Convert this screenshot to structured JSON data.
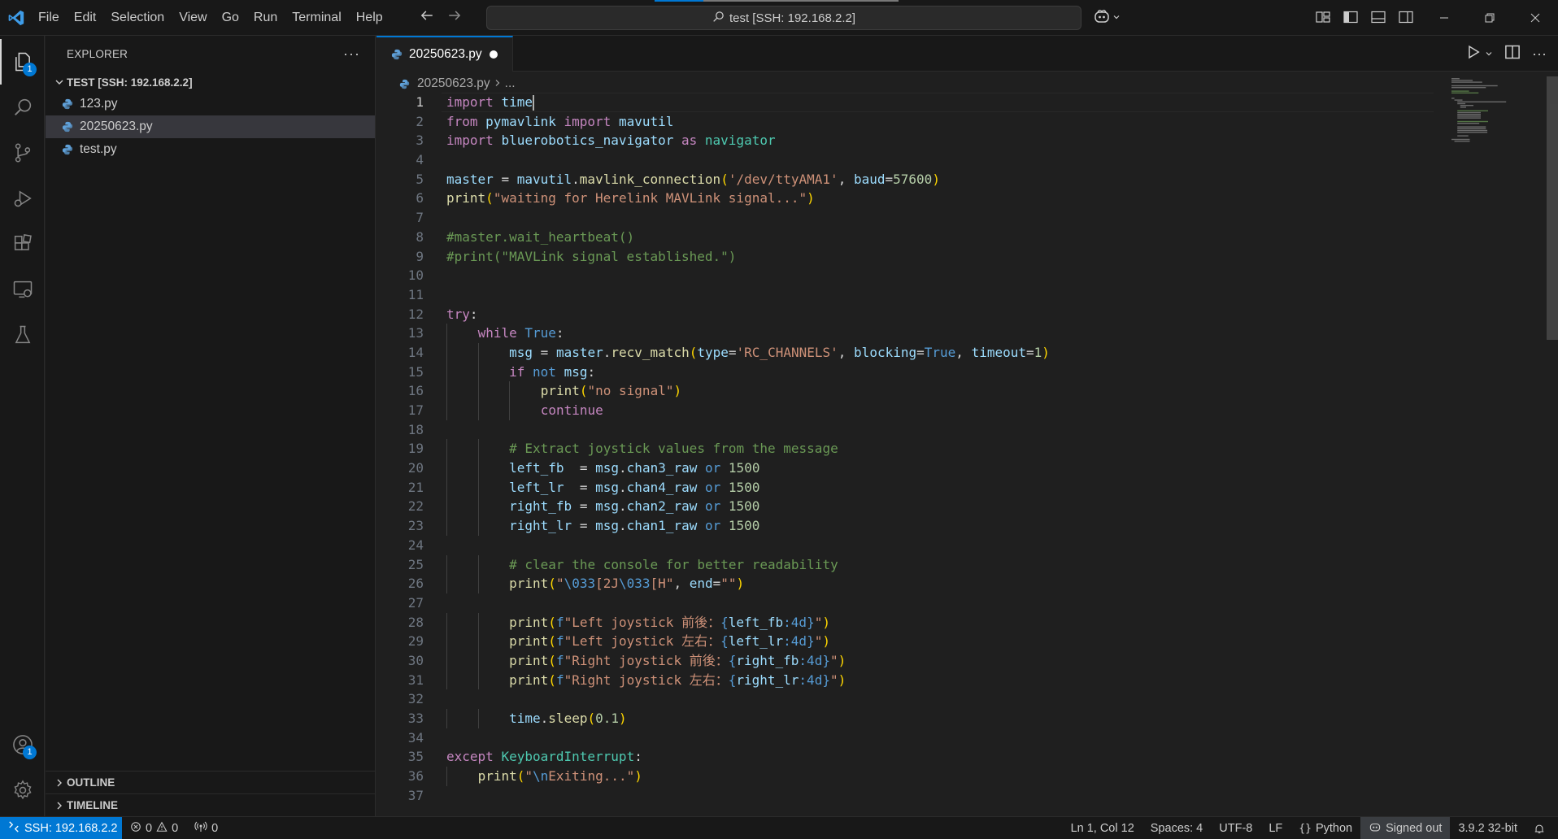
{
  "titlebar": {
    "menu": [
      "File",
      "Edit",
      "Selection",
      "View",
      "Go",
      "Run",
      "Terminal",
      "Help"
    ],
    "command_center": "test [SSH: 192.168.2.2]",
    "icons": {
      "logo": "vscode-logo-icon",
      "back": "arrow-left-icon",
      "forward": "arrow-right-icon",
      "search": "search-icon",
      "copilot": "copilot-icon",
      "layout": [
        "customize-layout-icon",
        "toggle-primary-sidebar-icon",
        "toggle-panel-icon",
        "toggle-secondary-sidebar-icon"
      ],
      "window": [
        "minimize-icon",
        "restore-icon",
        "close-icon"
      ]
    }
  },
  "activitybar": {
    "items": [
      "explorer-icon",
      "search-icon",
      "source-control-icon",
      "run-debug-icon",
      "extensions-icon",
      "remote-explorer-icon",
      "testing-icon"
    ],
    "explorer_badge": "1",
    "accounts_badge": "1",
    "bottom": [
      "accounts-icon",
      "manage-gear-icon"
    ]
  },
  "sidebar": {
    "title": "EXPLORER",
    "folder": "TEST [SSH: 192.168.2.2]",
    "files": [
      {
        "name": "123.py",
        "selected": false
      },
      {
        "name": "20250623.py",
        "selected": true
      },
      {
        "name": "test.py",
        "selected": false
      }
    ],
    "outline": "OUTLINE",
    "timeline": "TIMELINE"
  },
  "editor": {
    "tab": "20250623.py",
    "breadcrumb": {
      "file": "20250623.py",
      "rest": "..."
    },
    "current_line": 1,
    "lines": [
      "import time",
      "from pymavlink import mavutil",
      "import bluerobotics_navigator as navigator",
      "",
      "master = mavutil.mavlink_connection('/dev/ttyAMA1', baud=57600)",
      "print(\"waiting for Herelink MAVLink signal...\")",
      "",
      "#master.wait_heartbeat()",
      "#print(\"MAVLink signal established.\")",
      "",
      "",
      "try:",
      "    while True:",
      "        msg = master.recv_match(type='RC_CHANNELS', blocking=True, timeout=1)",
      "        if not msg:",
      "            print(\"no signal\")",
      "            continue",
      "",
      "        # Extract joystick values from the message",
      "        left_fb  = msg.chan3_raw or 1500",
      "        left_lr  = msg.chan4_raw or 1500",
      "        right_fb = msg.chan2_raw or 1500",
      "        right_lr = msg.chan1_raw or 1500",
      "",
      "        # clear the console for better readability",
      "        print(\"\\033[2J\\033[H\", end=\"\")",
      "",
      "        print(f\"Left joystick 前後：{left_fb:4d}\")",
      "        print(f\"Left joystick 左右：{left_lr:4d}\")",
      "        print(f\"Right joystick 前後：{right_fb:4d}\")",
      "        print(f\"Right joystick 左右：{right_lr:4d}\")",
      "",
      "        time.sleep(0.1)",
      "",
      "except KeyboardInterrupt:",
      "    print(\"\\nExiting...\")",
      ""
    ]
  },
  "statusbar": {
    "remote": "SSH: 192.168.2.2",
    "errors": "0",
    "warnings": "0",
    "ports": "0",
    "position": "Ln 1, Col 12",
    "spaces": "Spaces: 4",
    "encoding": "UTF-8",
    "eol": "LF",
    "language": "Python",
    "account": "Signed out",
    "interpreter": "3.9.2 32-bit"
  },
  "colors": {
    "accent": "#0078d4",
    "background": "#1f1f1f",
    "sidebar": "#181818"
  }
}
